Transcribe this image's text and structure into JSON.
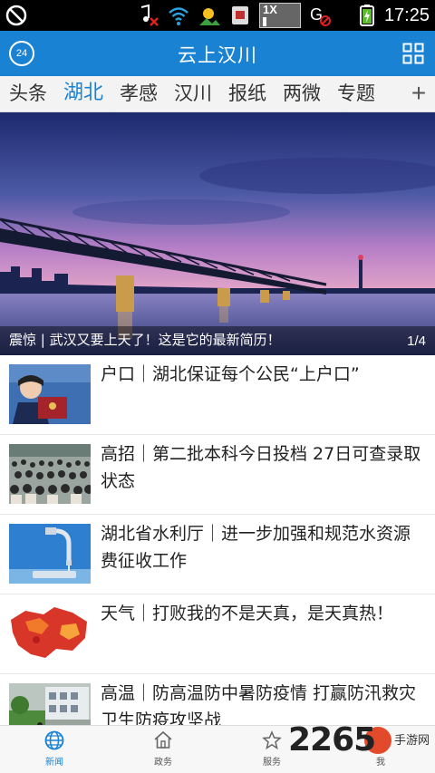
{
  "status_bar": {
    "time": "17:25",
    "icons": [
      "no-signal-icon",
      "music-muted-icon",
      "wifi-icon",
      "weather-sun-icon",
      "sim-card-icon",
      "network-1x-icon",
      "location-off-icon",
      "battery-charging-icon"
    ],
    "network_badge": "1X"
  },
  "header": {
    "title": "云上汉川",
    "left_badge": "24",
    "accent": "#1a82d3"
  },
  "tabs": {
    "items": [
      "头条",
      "湖北",
      "孝感",
      "汉川",
      "报纸",
      "两微",
      "专题"
    ],
    "active": "湖北",
    "add_symbol": "+"
  },
  "banner": {
    "caption": "震惊 | 武汉又要上天了！这是它的最新简历！",
    "pager": "1/4"
  },
  "news": [
    {
      "title": "户口｜湖北保证每个公民“上户口”"
    },
    {
      "title": "高招｜第二批本科今日投档 27日可查录取状态"
    },
    {
      "title": "湖北省水利厅｜进一步加强和规范水资源费征收工作"
    },
    {
      "title": "天气｜打败我的不是天真，是天真热！"
    },
    {
      "title": "高温｜防高温防中暑防疫情 打赢防汛救灾卫生防疫攻坚战"
    }
  ],
  "bottom_nav": {
    "items": [
      {
        "label": "新闻",
        "icon": "globe-icon",
        "active": true
      },
      {
        "label": "政务",
        "icon": "home-icon",
        "active": false
      },
      {
        "label": "服务",
        "icon": "star-icon",
        "active": false
      },
      {
        "label": "我",
        "icon": "user-icon",
        "active": false
      }
    ]
  },
  "watermark": {
    "number": "2265",
    "text": "手游网"
  }
}
